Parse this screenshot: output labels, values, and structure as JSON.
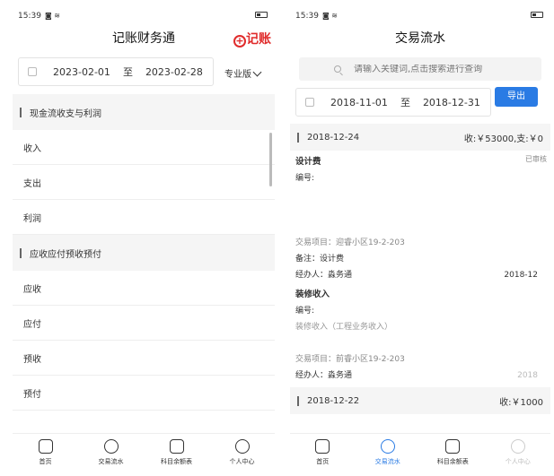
{
  "left": {
    "status": {
      "time": "15:39"
    },
    "title": "记账财务通",
    "add_label": "记账",
    "date_range": {
      "start": "2023-02-01",
      "sep": "至",
      "end": "2023-02-28"
    },
    "version_label": "专业版",
    "sections": [
      {
        "title": "现金流收支与利润",
        "items": [
          "收入",
          "支出",
          "利润"
        ]
      },
      {
        "title": "应收应付预收预付",
        "items": [
          "应收",
          "应付",
          "预收",
          "预付"
        ]
      }
    ]
  },
  "right": {
    "status": {
      "time": "15:39"
    },
    "title": "交易流水",
    "search_placeholder": "请输入关键词,点击搜索进行查询",
    "date_range": {
      "start": "2018-11-01",
      "sep": "至",
      "end": "2018-12-31"
    },
    "export_label": "导出",
    "days": [
      {
        "date": "2018-12-24",
        "summary": "收:￥53000,支:￥0"
      },
      {
        "date": "2018-12-22",
        "summary": "收:￥1000"
      }
    ],
    "records": [
      {
        "name": "设计费",
        "status": "已审核",
        "number_label": "编号:",
        "project": "交易项目：迎睿小区19-2-203",
        "remark": "备注：设计费",
        "handler": "经办人：淼务通",
        "date": "2018-12"
      },
      {
        "name": "装修收入",
        "number_label": "编号:",
        "type_line": "装修收入（工程业务收入）",
        "project": "交易项目：前睿小区19-2-203",
        "handler": "经办人：淼务通",
        "date": "2018"
      }
    ]
  },
  "tabs": [
    {
      "label": "首页",
      "icon": "home-icon"
    },
    {
      "label": "交易流水",
      "icon": "transactions-icon"
    },
    {
      "label": "科目余额表",
      "icon": "ledger-icon"
    },
    {
      "label": "个人中心",
      "icon": "profile-icon"
    }
  ],
  "colors": {
    "accent": "#2a7be4",
    "add": "#e02b2b"
  }
}
